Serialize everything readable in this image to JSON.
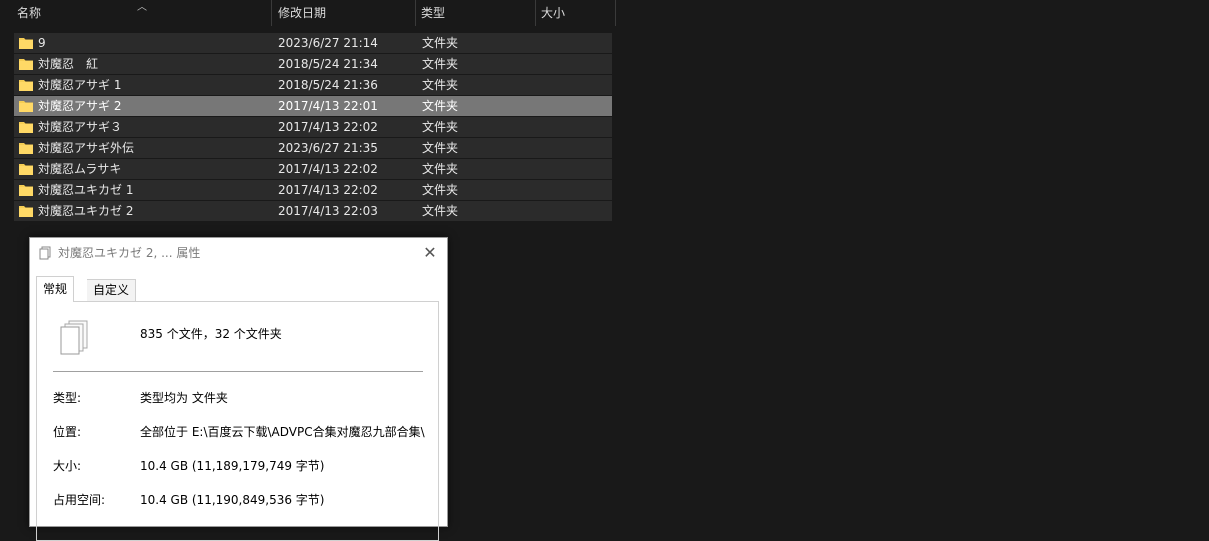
{
  "header": {
    "col_name": "名称",
    "col_date": "修改日期",
    "col_type": "类型",
    "col_size": "大小"
  },
  "rows": [
    {
      "name": "9",
      "date": "2023/6/27 21:14",
      "type": "文件夹"
    },
    {
      "name": "対魔忍　紅",
      "date": "2018/5/24 21:34",
      "type": "文件夹"
    },
    {
      "name": "対魔忍アサギ 1",
      "date": "2018/5/24 21:36",
      "type": "文件夹"
    },
    {
      "name": "対魔忍アサギ 2",
      "date": "2017/4/13 22:01",
      "type": "文件夹",
      "selected": true
    },
    {
      "name": "対魔忍アサギ３",
      "date": "2017/4/13 22:02",
      "type": "文件夹"
    },
    {
      "name": "対魔忍アサギ外伝",
      "date": "2023/6/27 21:35",
      "type": "文件夹"
    },
    {
      "name": "対魔忍ムラサキ",
      "date": "2017/4/13 22:02",
      "type": "文件夹"
    },
    {
      "name": "対魔忍ユキカゼ 1",
      "date": "2017/4/13 22:02",
      "type": "文件夹"
    },
    {
      "name": "対魔忍ユキカゼ 2",
      "date": "2017/4/13 22:03",
      "type": "文件夹"
    }
  ],
  "dialog": {
    "title": "対魔忍ユキカゼ 2, ... 属性",
    "tabs": [
      "常规",
      "自定义"
    ],
    "summary": "835 个文件，32 个文件夹",
    "props": [
      {
        "label": "类型:",
        "value": "类型均为 文件夹"
      },
      {
        "label": "位置:",
        "value": "全部位于 E:\\百度云下载\\ADVPC合集对魔忍九部合集\\"
      },
      {
        "label": "大小:",
        "value": "10.4 GB (11,189,179,749 字节)"
      },
      {
        "label": "占用空间:",
        "value": "10.4 GB (11,190,849,536 字节)"
      }
    ]
  },
  "icons": {
    "folder": "folder-icon",
    "sort": "sort-up-icon",
    "close": "close-icon",
    "files": "multiple-files-icon"
  },
  "colors": {
    "folder": "#f5cd54",
    "row_bg": "#2b2b2b",
    "selected_bg": "#777777",
    "background": "#191919"
  }
}
